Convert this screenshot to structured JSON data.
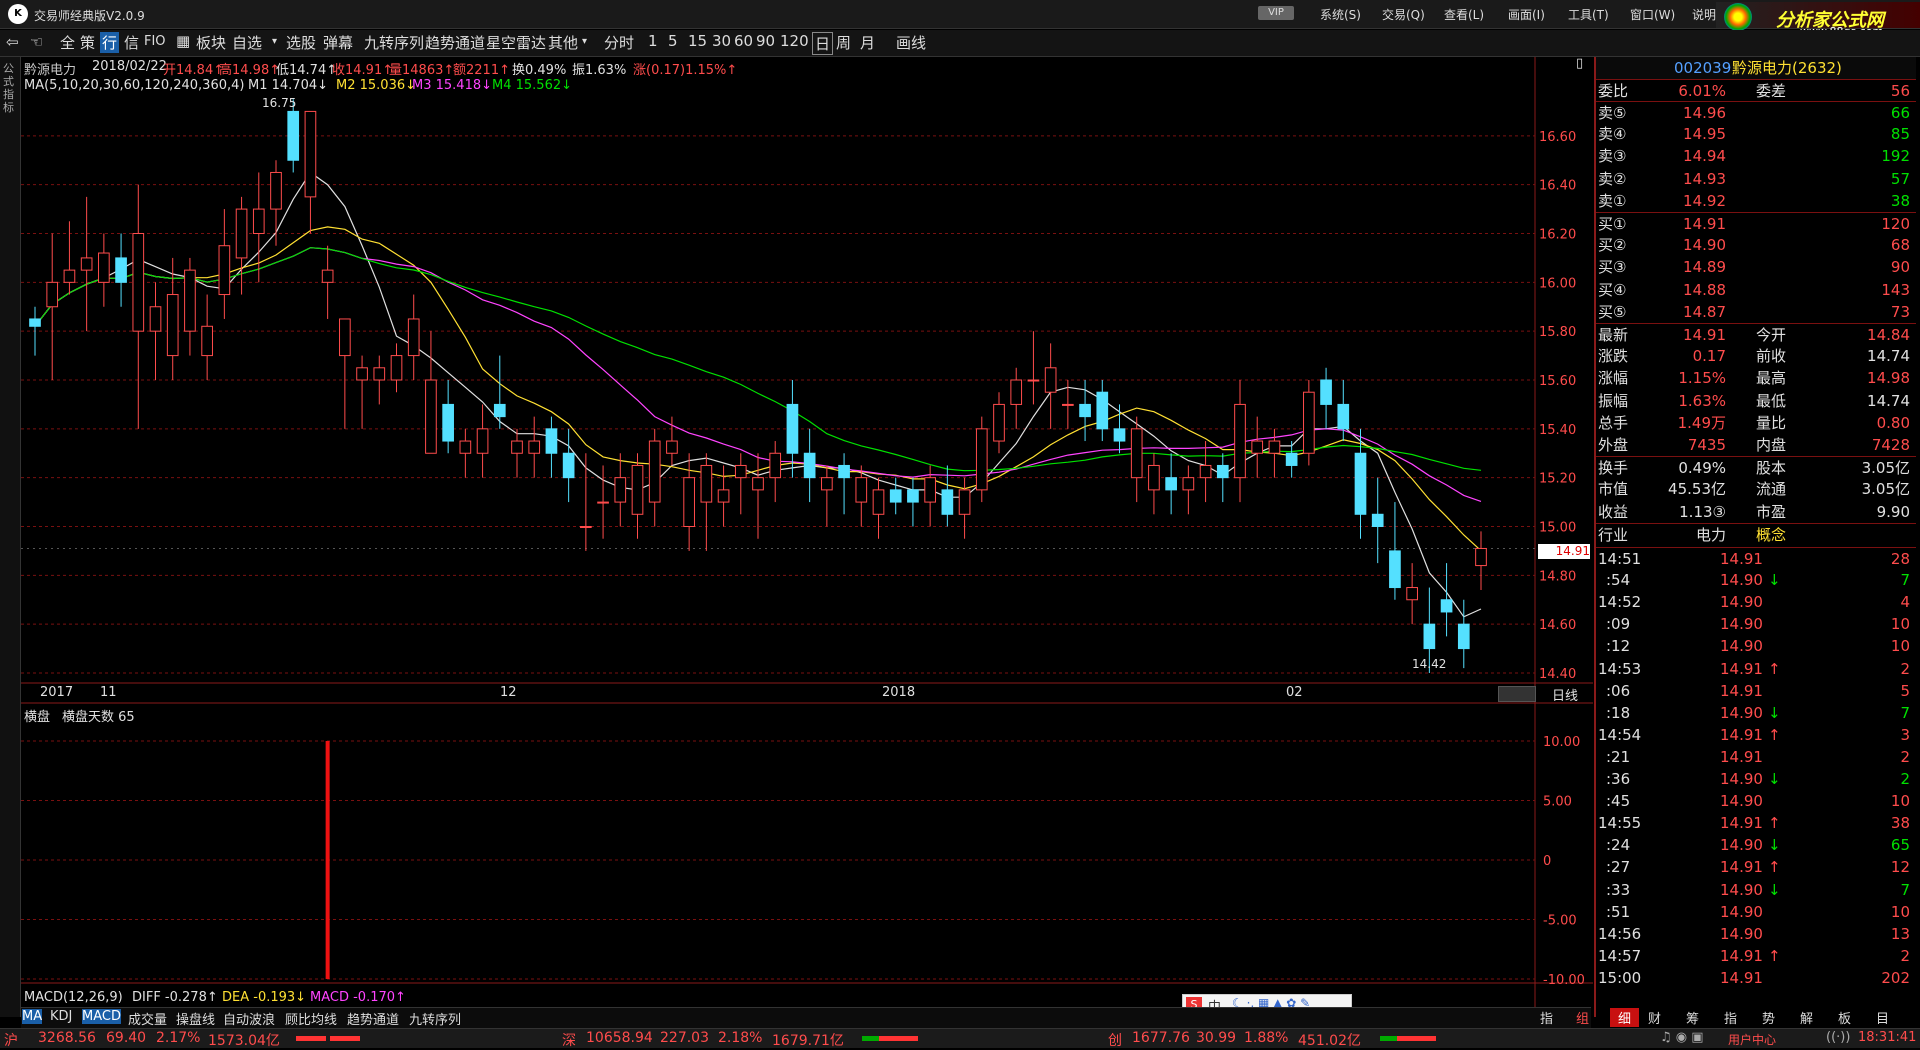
{
  "window": {
    "title": "交易师经典版V2.0.9",
    "vip": "VIP",
    "menu": [
      "系统(S)",
      "交易(Q)",
      "查看(L)",
      "画面(I)",
      "工具(T)",
      "窗口(W)",
      "说明"
    ]
  },
  "brand": {
    "title": "分析家公式网",
    "url": "www.88gs.com"
  },
  "toolbar": {
    "items": [
      "全",
      "策",
      "行",
      "信",
      "FIO",
      "板块",
      "自选",
      "选股",
      "弹幕",
      "九转序列",
      "趋势通道",
      "星空雷达",
      "其他",
      "分时",
      "1",
      "5",
      "15",
      "30",
      "60",
      "90",
      "120",
      "日",
      "周",
      "月",
      "画线"
    ]
  },
  "leftbar": {
    "label": "公式指标"
  },
  "quote_line": {
    "name": "黔源电力",
    "date": "2018/02/22",
    "open": "开14.84↑",
    "high": "高14.98↑",
    "low": "低14.74↑",
    "close": "收14.91↑",
    "volume": "量14863↑",
    "amount": "额2211↑",
    "turnover": "换0.49%",
    "amplitude": "振1.63%",
    "change": "涨(0.17)1.15%↑"
  },
  "ma_line": {
    "label": "MA(5,10,20,30,60,120,240,360,4)",
    "m1": "M1 14.704↓",
    "m2": "M2 15.036↓",
    "m3": "M3 15.418↓",
    "m4": "M4 15.562↓"
  },
  "chart_labels": {
    "high_mark": "16.75",
    "low_mark": "14.42",
    "price_tag": "14.91",
    "period_label": "日线"
  },
  "date_axis": [
    "2017",
    "11",
    "12",
    "2018",
    "02"
  ],
  "sub_indicator": {
    "name": "横盘",
    "days_label": "横盘天数 65"
  },
  "macd_line": {
    "label": "MACD(12,26,9)",
    "diff": "DIFF -0.278↑",
    "dea": "DEA -0.193↓",
    "macd": "MACD -0.170↑"
  },
  "colors": {
    "up": "#ff4c4c",
    "down": "#54e0ff",
    "m1": "#e0e0e0",
    "m2": "#ffe033",
    "m3": "#ff44ff",
    "m4": "#00e000",
    "grid": "#7a1010"
  },
  "chart_data": {
    "type": "candlestick",
    "y_axis": {
      "ticks": [
        "16.60",
        "16.40",
        "16.20",
        "16.00",
        "15.80",
        "15.60",
        "15.40",
        "15.20",
        "15.00",
        "14.80",
        "14.60",
        "14.40"
      ],
      "range": [
        14.4,
        16.8
      ]
    },
    "candles": [
      [
        15.85,
        15.9,
        15.7,
        15.82
      ],
      [
        15.9,
        16.2,
        15.6,
        16.0
      ],
      [
        16.0,
        16.25,
        15.95,
        16.05
      ],
      [
        16.05,
        16.35,
        15.8,
        16.1
      ],
      [
        16.0,
        16.2,
        15.9,
        16.12
      ],
      [
        16.1,
        16.2,
        15.9,
        16.0
      ],
      [
        15.8,
        16.4,
        15.4,
        16.2
      ],
      [
        15.8,
        16.0,
        15.6,
        15.9
      ],
      [
        15.7,
        16.1,
        15.6,
        15.95
      ],
      [
        15.8,
        16.1,
        15.7,
        16.05
      ],
      [
        15.7,
        15.95,
        15.6,
        15.82
      ],
      [
        15.95,
        16.3,
        15.85,
        16.15
      ],
      [
        16.1,
        16.35,
        15.95,
        16.3
      ],
      [
        16.2,
        16.45,
        16.0,
        16.3
      ],
      [
        16.3,
        16.5,
        16.15,
        16.45
      ],
      [
        16.7,
        16.75,
        16.45,
        16.5
      ],
      [
        16.35,
        16.7,
        16.2,
        16.7
      ],
      [
        16.0,
        16.15,
        15.85,
        16.05
      ],
      [
        15.7,
        15.85,
        15.4,
        15.85
      ],
      [
        15.6,
        15.7,
        15.4,
        15.65
      ],
      [
        15.6,
        15.7,
        15.5,
        15.65
      ],
      [
        15.6,
        15.75,
        15.55,
        15.7
      ],
      [
        15.7,
        15.95,
        15.6,
        15.85
      ],
      [
        15.3,
        15.8,
        15.3,
        15.6
      ],
      [
        15.5,
        15.6,
        15.3,
        15.35
      ],
      [
        15.3,
        15.4,
        15.2,
        15.35
      ],
      [
        15.3,
        15.5,
        15.2,
        15.4
      ],
      [
        15.5,
        15.7,
        15.4,
        15.45
      ],
      [
        15.3,
        15.4,
        15.2,
        15.35
      ],
      [
        15.3,
        15.45,
        15.2,
        15.35
      ],
      [
        15.4,
        15.45,
        15.2,
        15.3
      ],
      [
        15.3,
        15.4,
        15.1,
        15.2
      ],
      [
        15.0,
        15.3,
        14.9,
        15.0
      ],
      [
        15.1,
        15.25,
        14.95,
        15.1
      ],
      [
        15.1,
        15.3,
        15.0,
        15.2
      ],
      [
        15.05,
        15.3,
        14.95,
        15.25
      ],
      [
        15.1,
        15.4,
        15.0,
        15.35
      ],
      [
        15.3,
        15.45,
        15.25,
        15.35
      ],
      [
        15.0,
        15.3,
        14.9,
        15.2
      ],
      [
        15.1,
        15.3,
        14.9,
        15.25
      ],
      [
        15.1,
        15.25,
        15.0,
        15.15
      ],
      [
        15.2,
        15.3,
        15.05,
        15.25
      ],
      [
        15.15,
        15.3,
        14.95,
        15.2
      ],
      [
        15.2,
        15.35,
        15.1,
        15.3
      ],
      [
        15.5,
        15.6,
        15.2,
        15.3
      ],
      [
        15.3,
        15.4,
        15.1,
        15.2
      ],
      [
        15.15,
        15.25,
        15.0,
        15.2
      ],
      [
        15.25,
        15.3,
        15.05,
        15.2
      ],
      [
        15.1,
        15.25,
        15.0,
        15.2
      ],
      [
        15.05,
        15.2,
        14.95,
        15.15
      ],
      [
        15.15,
        15.2,
        15.05,
        15.1
      ],
      [
        15.15,
        15.2,
        15.0,
        15.1
      ],
      [
        15.1,
        15.25,
        15.0,
        15.2
      ],
      [
        15.15,
        15.25,
        15.0,
        15.05
      ],
      [
        15.05,
        15.2,
        14.95,
        15.15
      ],
      [
        15.15,
        15.45,
        15.1,
        15.4
      ],
      [
        15.35,
        15.55,
        15.3,
        15.5
      ],
      [
        15.5,
        15.65,
        15.4,
        15.6
      ],
      [
        15.6,
        15.8,
        15.5,
        15.6
      ],
      [
        15.55,
        15.75,
        15.4,
        15.65
      ],
      [
        15.5,
        15.6,
        15.4,
        15.5
      ],
      [
        15.5,
        15.6,
        15.35,
        15.45
      ],
      [
        15.55,
        15.6,
        15.35,
        15.4
      ],
      [
        15.4,
        15.5,
        15.3,
        15.35
      ],
      [
        15.2,
        15.45,
        15.1,
        15.4
      ],
      [
        15.15,
        15.3,
        15.05,
        15.25
      ],
      [
        15.2,
        15.3,
        15.05,
        15.15
      ],
      [
        15.15,
        15.25,
        15.05,
        15.2
      ],
      [
        15.2,
        15.35,
        15.1,
        15.25
      ],
      [
        15.25,
        15.3,
        15.1,
        15.2
      ],
      [
        15.2,
        15.6,
        15.1,
        15.5
      ],
      [
        15.3,
        15.45,
        15.2,
        15.35
      ],
      [
        15.3,
        15.4,
        15.2,
        15.35
      ],
      [
        15.3,
        15.35,
        15.2,
        15.25
      ],
      [
        15.3,
        15.6,
        15.25,
        15.55
      ],
      [
        15.6,
        15.65,
        15.4,
        15.5
      ],
      [
        15.5,
        15.6,
        15.35,
        15.4
      ],
      [
        15.3,
        15.4,
        14.95,
        15.05
      ],
      [
        15.05,
        15.2,
        14.85,
        15.0
      ],
      [
        14.9,
        15.1,
        14.7,
        14.75
      ],
      [
        14.7,
        14.85,
        14.6,
        14.75
      ],
      [
        14.6,
        14.75,
        14.4,
        14.5
      ],
      [
        14.7,
        14.85,
        14.55,
        14.65
      ],
      [
        14.6,
        14.7,
        14.42,
        14.5
      ],
      [
        14.84,
        14.98,
        14.74,
        14.91
      ]
    ],
    "indicator_bar": {
      "index": 17,
      "range": [
        -10.0,
        10.0
      ],
      "ticks": [
        "10.00",
        "5.00",
        "0",
        "-5.00",
        "-10.00"
      ]
    }
  },
  "right_panel": {
    "header": {
      "code": "002039",
      "name": "黔源电力(2632)"
    },
    "weibi": {
      "label": "委比",
      "value": "6.01%",
      "label2": "委差",
      "value2": "56"
    },
    "asks": [
      {
        "label": "卖⑤",
        "price": "14.96",
        "vol": "66"
      },
      {
        "label": "卖④",
        "price": "14.95",
        "vol": "85"
      },
      {
        "label": "卖③",
        "price": "14.94",
        "vol": "192"
      },
      {
        "label": "卖②",
        "price": "14.93",
        "vol": "57"
      },
      {
        "label": "卖①",
        "price": "14.92",
        "vol": "38"
      }
    ],
    "bids": [
      {
        "label": "买①",
        "price": "14.91",
        "vol": "120"
      },
      {
        "label": "买②",
        "price": "14.90",
        "vol": "68"
      },
      {
        "label": "买③",
        "price": "14.89",
        "vol": "90"
      },
      {
        "label": "买④",
        "price": "14.88",
        "vol": "143"
      },
      {
        "label": "买⑤",
        "price": "14.87",
        "vol": "73"
      }
    ],
    "stats": [
      {
        "l1": "最新",
        "v1": "14.91",
        "l2": "今开",
        "v2": "14.84"
      },
      {
        "l1": "涨跌",
        "v1": "0.17",
        "l2": "前收",
        "v2": "14.74"
      },
      {
        "l1": "涨幅",
        "v1": "1.15%",
        "l2": "最高",
        "v2": "14.98"
      },
      {
        "l1": "振幅",
        "v1": "1.63%",
        "l2": "最低",
        "v2": "14.74"
      },
      {
        "l1": "总手",
        "v1": "1.49万",
        "l2": "量比",
        "v2": "0.80"
      },
      {
        "l1": "外盘",
        "v1": "7435",
        "l2": "内盘",
        "v2": "7428"
      },
      {
        "l1": "换手",
        "v1": "0.49%",
        "l2": "股本",
        "v2": "3.05亿"
      },
      {
        "l1": "市值",
        "v1": "45.53亿",
        "l2": "流通",
        "v2": "3.05亿"
      },
      {
        "l1": "收益",
        "v1": "1.13③",
        "l2": "市盈",
        "v2": "9.90"
      },
      {
        "l1": "行业",
        "v1": "电力",
        "l2": "概念",
        "v2": ""
      }
    ],
    "ticks": [
      {
        "t": "14:51",
        "p": "14.91",
        "a": "",
        "v": "28"
      },
      {
        "t": ":54",
        "p": "14.90",
        "a": "↓",
        "v": "7"
      },
      {
        "t": "14:52",
        "p": "14.90",
        "a": "",
        "v": "4"
      },
      {
        "t": ":09",
        "p": "14.90",
        "a": "",
        "v": "10"
      },
      {
        "t": ":12",
        "p": "14.90",
        "a": "",
        "v": "10"
      },
      {
        "t": "14:53",
        "p": "14.91",
        "a": "↑",
        "v": "2"
      },
      {
        "t": ":06",
        "p": "14.91",
        "a": "",
        "v": "5"
      },
      {
        "t": ":18",
        "p": "14.90",
        "a": "↓",
        "v": "7"
      },
      {
        "t": "14:54",
        "p": "14.91",
        "a": "↑",
        "v": "3"
      },
      {
        "t": ":21",
        "p": "14.91",
        "a": "",
        "v": "2"
      },
      {
        "t": ":36",
        "p": "14.90",
        "a": "↓",
        "v": "2"
      },
      {
        "t": ":45",
        "p": "14.90",
        "a": "",
        "v": "10"
      },
      {
        "t": "14:55",
        "p": "14.91",
        "a": "↑",
        "v": "38"
      },
      {
        "t": ":24",
        "p": "14.90",
        "a": "↓",
        "v": "65"
      },
      {
        "t": ":27",
        "p": "14.91",
        "a": "↑",
        "v": "12"
      },
      {
        "t": ":33",
        "p": "14.90",
        "a": "↓",
        "v": "7"
      },
      {
        "t": ":51",
        "p": "14.90",
        "a": "",
        "v": "10"
      },
      {
        "t": "14:56",
        "p": "14.90",
        "a": "",
        "v": "13"
      },
      {
        "t": "14:57",
        "p": "14.91",
        "a": "↑",
        "v": "2"
      },
      {
        "t": "15:00",
        "p": "14.91",
        "a": "",
        "v": "202"
      }
    ],
    "tabs": [
      "细",
      "财",
      "筹",
      "指",
      "势",
      "解",
      "板",
      "目"
    ]
  },
  "bottom_tabs": [
    "MA",
    "KDJ",
    "MACD",
    "成交量",
    "操盘线",
    "自动波浪",
    "顾比均线",
    "趋势通道",
    "九转序列"
  ],
  "right_bottom": [
    "指",
    "组"
  ],
  "status": {
    "sh": {
      "label": "沪",
      "value": "3268.56",
      "chg": "69.40",
      "pct": "2.17%",
      "amt": "1573.04亿"
    },
    "sz": {
      "label": "深",
      "value": "10658.94",
      "chg": "227.03",
      "pct": "2.18%",
      "amt": "1679.71亿"
    },
    "cy": {
      "label": "创",
      "value": "1677.76",
      "chg": "30.99",
      "pct": "1.88%",
      "amt": "451.02亿"
    },
    "user": "用户中心",
    "time": "18:31:41"
  },
  "ime": {
    "label": "中"
  }
}
